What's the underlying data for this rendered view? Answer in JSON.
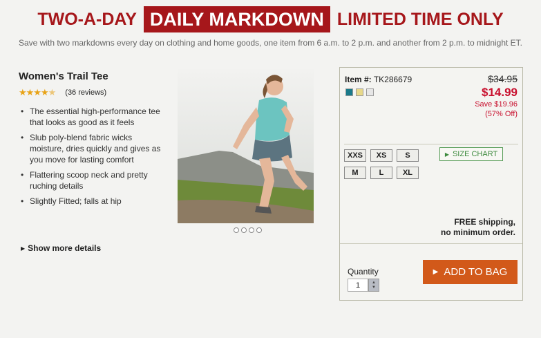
{
  "banner": {
    "left": "TWO-A-DAY",
    "middle": "DAILY MARKDOWN",
    "right": "LIMITED TIME ONLY",
    "subtitle": "Save with two markdowns every day on clothing and home goods, one item from 6 a.m. to 2 p.m. and another from 2 p.m. to midnight ET.",
    "accent_color": "#a6171b"
  },
  "product": {
    "title": "Women's Trail Tee",
    "rating": 4.5,
    "rating_stars_icon": "star-icon",
    "reviews": "(36 reviews)",
    "features": [
      "The essential high-performance tee that looks as good as it feels",
      "Slub poly-blend fabric wicks moisture, dries quickly and gives as you move for lasting comfort",
      "Flattering scoop neck and pretty ruching details",
      "Slightly Fitted; falls at hip"
    ],
    "show_more": "Show more details",
    "image_count": 4,
    "active_image": 1
  },
  "panel": {
    "item_label": "Item #:",
    "item_number": "TK286679",
    "swatches": [
      "#1a7a8a",
      "#e8d98a",
      "#e6e6e6"
    ],
    "original_price": "$34.95",
    "sale_price": "$14.99",
    "save_amount": "Save $19.96",
    "save_percent": "(57% Off)",
    "sizes": [
      "XXS",
      "XS",
      "S",
      "M",
      "L",
      "XL"
    ],
    "size_chart": "SIZE CHART",
    "shipping_line1": "FREE shipping,",
    "shipping_line2": "no minimum order.",
    "quantity_label": "Quantity",
    "quantity_value": "1",
    "add_to_bag": "ADD TO BAG",
    "button_color": "#d2591a",
    "price_color": "#c8102e"
  }
}
